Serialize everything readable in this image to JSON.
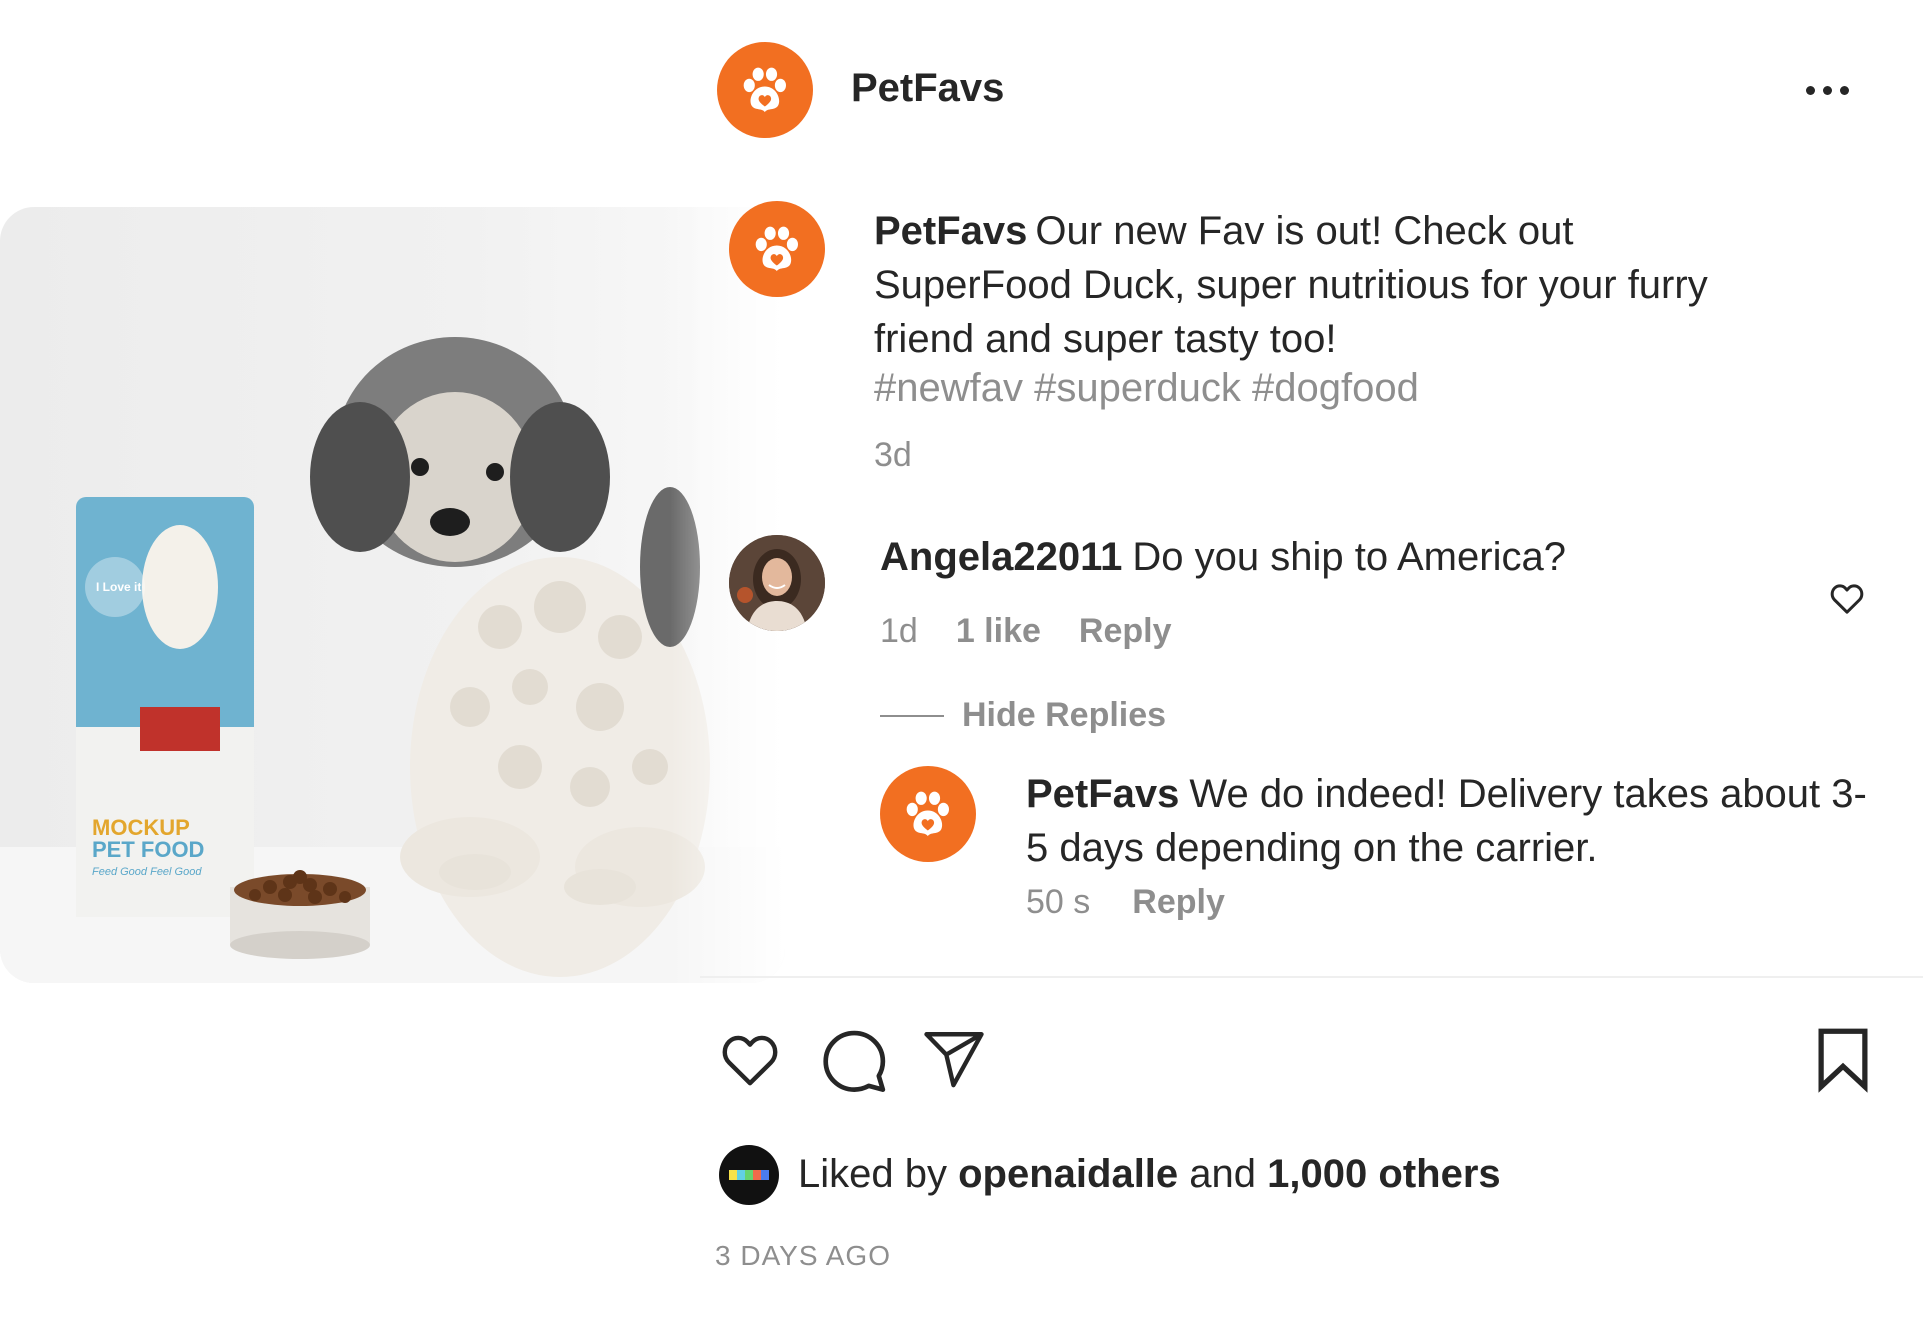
{
  "post": {
    "username": "PetFavs",
    "avatar_icon": "paw-icon",
    "accent_color": "#f26f21",
    "more_icon": "more-horizontal-icon"
  },
  "photo": {
    "package_labels": [
      "I Love it",
      "MOCKUP",
      "PET FOOD",
      "Feed Good Feel Good"
    ]
  },
  "caption": {
    "username": "PetFavs",
    "text": "Our new Fav is out! Check out SuperFood Duck, super nutritious for your furry friend and super tasty too!",
    "hashtags": "#newfav #superduck #dogfood",
    "time": "3d"
  },
  "comments": [
    {
      "username": "Angela22011",
      "text": "Do you ship to America?",
      "time": "1d",
      "likes": "1 like",
      "reply_label": "Reply",
      "hide_replies_label": "Hide Replies",
      "heart_icon": "heart-outline-icon",
      "replies": [
        {
          "username": "PetFavs",
          "text": "We do indeed! Delivery takes about 3-5 days depending on the carrier.",
          "time": "50 s",
          "reply_label": "Reply"
        }
      ]
    }
  ],
  "actions": {
    "like_icon": "heart-icon",
    "comment_icon": "comment-icon",
    "share_icon": "send-icon",
    "save_icon": "bookmark-icon"
  },
  "likes": {
    "prefix": "Liked by",
    "user": "openaidalle",
    "and": "and",
    "others": "1,000 others"
  },
  "date": "3 DAYS AGO"
}
